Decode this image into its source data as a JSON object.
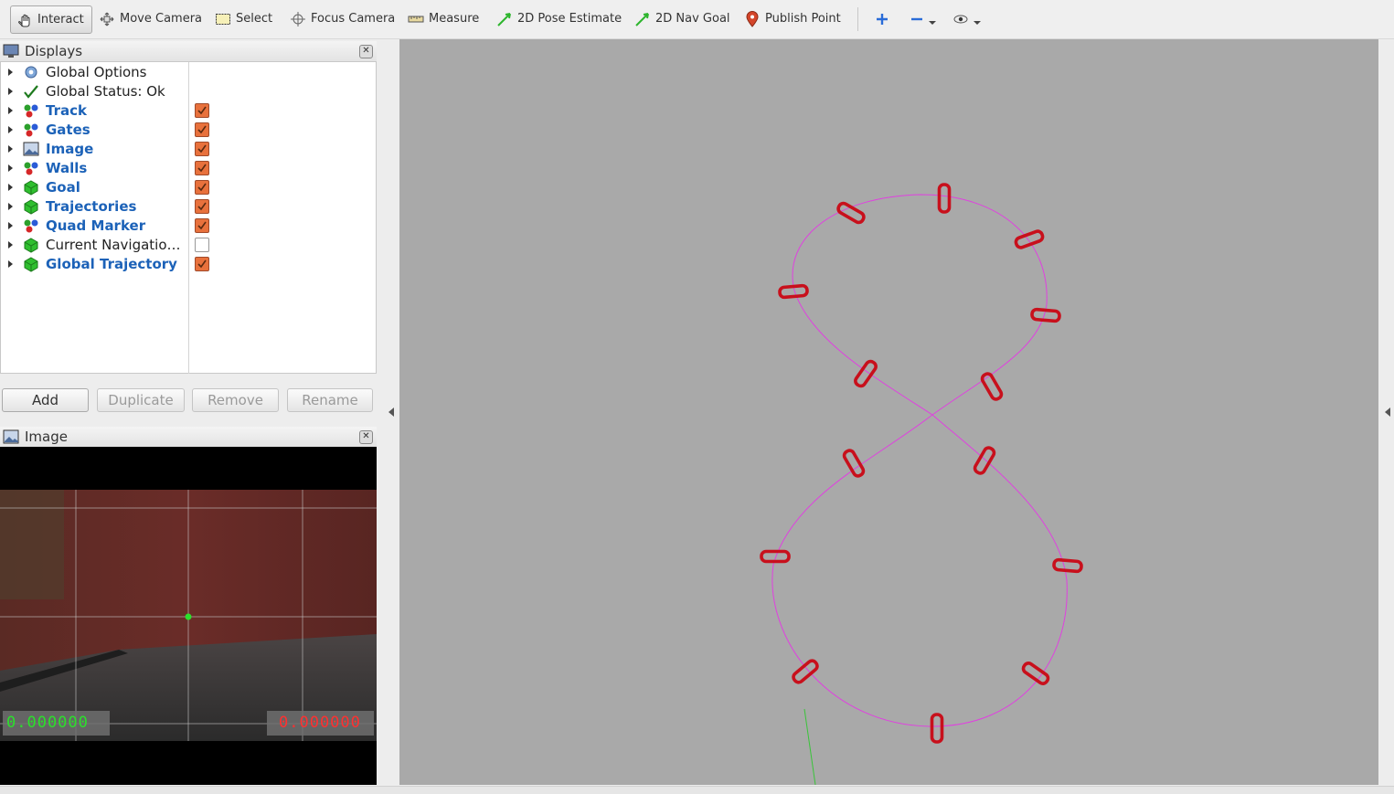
{
  "toolbar": {
    "interact": "Interact",
    "move_camera": "Move Camera",
    "select": "Select",
    "focus_camera": "Focus Camera",
    "measure": "Measure",
    "pose_estimate": "2D Pose Estimate",
    "nav_goal": "2D Nav Goal",
    "publish_point": "Publish Point"
  },
  "displays": {
    "title": "Displays",
    "items": [
      {
        "label": "Global Options",
        "icon": "gear-icon",
        "enabled": null
      },
      {
        "label": "Global Status: Ok",
        "icon": "checkmark-icon",
        "enabled": null
      },
      {
        "label": "Track",
        "icon": "marker-array-icon",
        "enabled": true
      },
      {
        "label": "Gates",
        "icon": "marker-array-icon",
        "enabled": true
      },
      {
        "label": "Image",
        "icon": "image-icon",
        "enabled": true
      },
      {
        "label": "Walls",
        "icon": "marker-array-icon",
        "enabled": true
      },
      {
        "label": "Goal",
        "icon": "cube-icon",
        "enabled": true
      },
      {
        "label": "Trajectories",
        "icon": "cube-icon",
        "enabled": true
      },
      {
        "label": "Quad Marker",
        "icon": "marker-array-icon",
        "enabled": true
      },
      {
        "label": "Current Navigatio…",
        "icon": "cube-icon",
        "enabled": false
      },
      {
        "label": "Global Trajectory",
        "icon": "cube-icon",
        "enabled": true
      }
    ],
    "buttons": {
      "add": "Add",
      "duplicate": "Duplicate",
      "remove": "Remove",
      "rename": "Rename"
    }
  },
  "image_panel": {
    "title": "Image",
    "left_readout": "0.000000",
    "right_readout": "0.000000"
  },
  "colors": {
    "accent_checkbox": "#e8713c",
    "enabled_label": "#1c62b8",
    "gate": "#c8101c",
    "trajectory": "#e040e0",
    "viewport_bg": "#a9a9a9"
  }
}
